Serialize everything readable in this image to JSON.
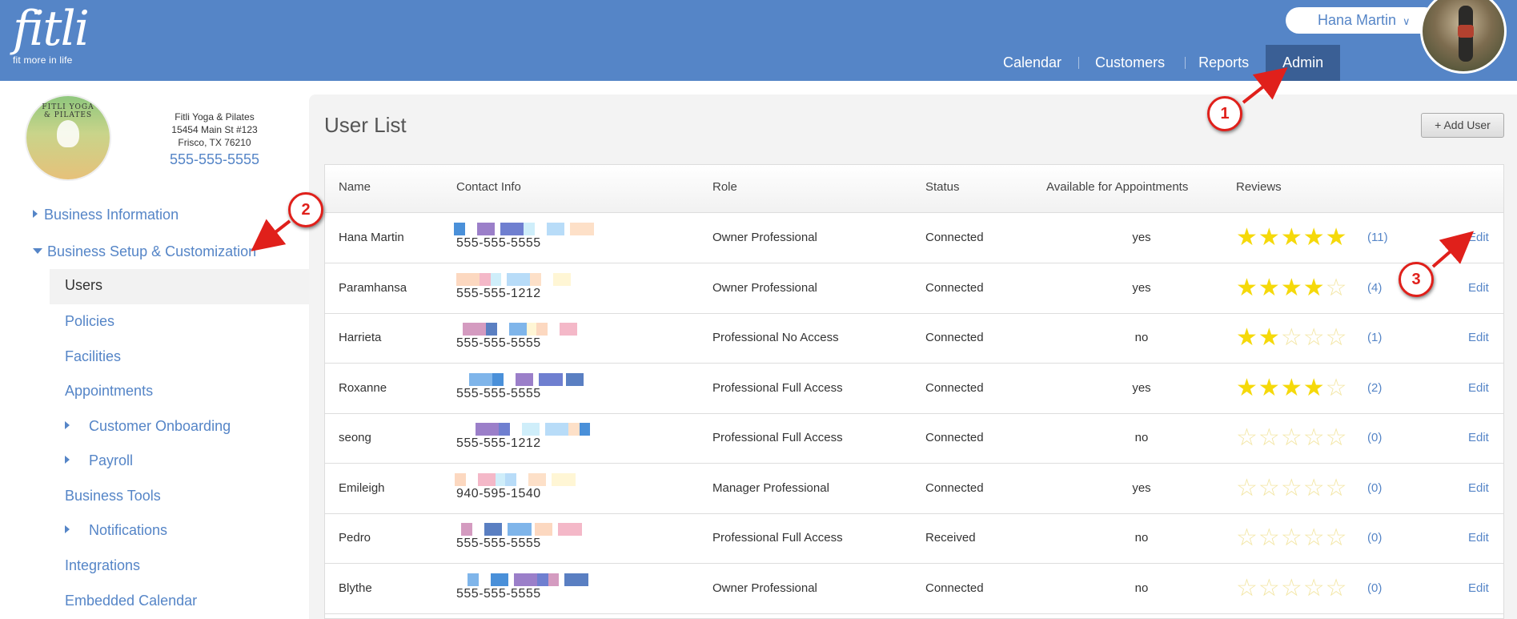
{
  "header": {
    "logo_word": "fitli",
    "logo_tagline": "fit more in life",
    "user_name": "Hana Martin",
    "nav": [
      "Calendar",
      "Customers",
      "Reports",
      "Admin"
    ],
    "active_nav": "Admin"
  },
  "business": {
    "logo_text": "FITLI YOGA & PILATES",
    "name": "Fitli Yoga & Pilates",
    "address1": "15454 Main St #123",
    "address2": "Frisco, TX 76210",
    "phone": "555-555-5555"
  },
  "sidebar": {
    "business_information": "Business Information",
    "business_setup": "Business Setup & Customization",
    "items": [
      "Users",
      "Policies",
      "Facilities",
      "Appointments",
      "Customer Onboarding",
      "Payroll",
      "Business Tools",
      "Notifications",
      "Integrations",
      "Embedded Calendar"
    ]
  },
  "main": {
    "title": "User List",
    "add_user_label": "+ Add User",
    "columns": [
      "Name",
      "Contact Info",
      "Role",
      "Status",
      "Available for Appointments",
      "Reviews"
    ],
    "edit_label": "Edit",
    "rows": [
      {
        "name": "Hana Martin",
        "phone": "555-555-5555",
        "role": "Owner Professional",
        "status": "Connected",
        "available": "yes",
        "rating": 5,
        "reviews": "(11)"
      },
      {
        "name": "Paramhansa",
        "phone": "555-555-1212",
        "role": "Owner Professional",
        "status": "Connected",
        "available": "yes",
        "rating": 4,
        "reviews": "(4)"
      },
      {
        "name": "Harrieta",
        "phone": "555-555-5555",
        "role": "Professional No Access",
        "status": "Connected",
        "available": "no",
        "rating": 2,
        "reviews": "(1)"
      },
      {
        "name": "Roxanne",
        "phone": "555-555-5555",
        "role": "Professional Full Access",
        "status": "Connected",
        "available": "yes",
        "rating": 4,
        "reviews": "(2)"
      },
      {
        "name": "seong",
        "phone": "555-555-1212",
        "role": "Professional Full Access",
        "status": "Connected",
        "available": "no",
        "rating": 0,
        "reviews": "(0)"
      },
      {
        "name": "Emileigh",
        "phone": "940-595-1540",
        "role": "Manager Professional",
        "status": "Connected",
        "available": "yes",
        "rating": 0,
        "reviews": "(0)"
      },
      {
        "name": "Pedro",
        "phone": "555-555-5555",
        "role": "Professional Full Access",
        "status": "Received",
        "available": "no",
        "rating": 0,
        "reviews": "(0)"
      },
      {
        "name": "Blythe",
        "phone": "555-555-5555",
        "role": "Owner Professional",
        "status": "Connected",
        "available": "no",
        "rating": 0,
        "reviews": "(0)"
      }
    ]
  },
  "callouts": [
    "1",
    "2",
    "3"
  ],
  "colors": {
    "header_blue": "#5585c7",
    "active_nav": "#3a5f95",
    "link": "#5585c7",
    "star": "#f5d90a",
    "callout_red": "#e0201b"
  }
}
